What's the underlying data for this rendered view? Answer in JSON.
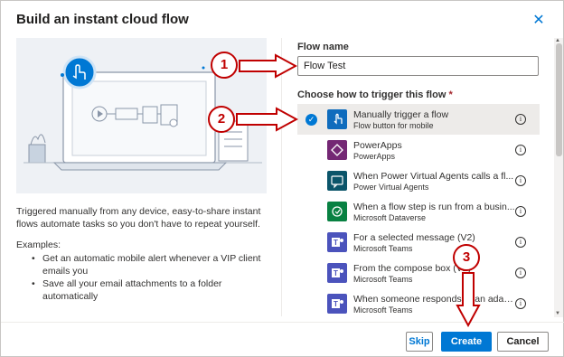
{
  "dialog": {
    "title": "Build an instant cloud flow",
    "close_glyph": "✕"
  },
  "illustration": {
    "accent": "#0078d4"
  },
  "description": "Triggered manually from any device, easy-to-share instant flows automate tasks so you don't have to repeat yourself.",
  "examples": {
    "label": "Examples:",
    "items": [
      "Get an automatic mobile alert whenever a VIP client emails you",
      "Save all your email attachments to a folder automatically"
    ]
  },
  "flow_name": {
    "label": "Flow name",
    "value": "Flow Test"
  },
  "trigger": {
    "label": "Choose how to trigger this flow",
    "required_mark": "*",
    "items": [
      {
        "name": "Manually trigger a flow",
        "sub": "Flow button for mobile",
        "icon": "hand-tap-icon",
        "color": "#0f6cbd",
        "selected": true
      },
      {
        "name": "PowerApps",
        "sub": "PowerApps",
        "icon": "powerapps-icon",
        "color": "#742774"
      },
      {
        "name": "When Power Virtual Agents calls a fl...",
        "sub": "Power Virtual Agents",
        "icon": "chat-bot-icon",
        "color": "#0b556a"
      },
      {
        "name": "When a flow step is run from a busin...",
        "sub": "Microsoft Dataverse",
        "icon": "dataverse-icon",
        "color": "#088142"
      },
      {
        "name": "For a selected message (V2)",
        "sub": "Microsoft Teams",
        "icon": "teams-icon",
        "color": "#4b53bc"
      },
      {
        "name": "From the compose box (V2)",
        "sub": "Microsoft Teams",
        "icon": "teams-icon",
        "color": "#4b53bc"
      },
      {
        "name": "When someone responds to an adapt...",
        "sub": "Microsoft Teams",
        "icon": "teams-icon",
        "color": "#4b53bc"
      }
    ]
  },
  "buttons": {
    "skip": "Skip",
    "create": "Create",
    "cancel": "Cancel"
  },
  "annotations": [
    "1",
    "2",
    "3"
  ],
  "colors": {
    "primary": "#0078d4",
    "annotation": "#c00000"
  }
}
